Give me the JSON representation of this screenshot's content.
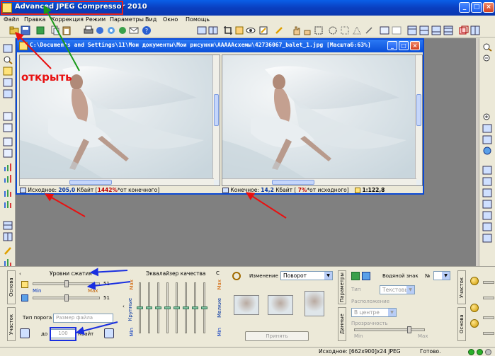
{
  "app": {
    "title": "Advanced JPEG Compressor 2010",
    "window_buttons": [
      "_",
      "□",
      "×"
    ]
  },
  "menu": [
    "Файл",
    "Правка",
    "Коррекция",
    "Режим",
    "Параметры",
    "Вид",
    "Окно",
    "Помощь"
  ],
  "document": {
    "title": "C:\\Documents and Settings\\11\\Мои документы\\Мои рисунки\\АААААсхемы\\42736067_balet_1.jpg [Масштаб:63%]",
    "buttons": [
      "_",
      "□",
      "×"
    ],
    "original_status": {
      "label": "Исходное:",
      "size": "205,0",
      "unit": "Кбайт",
      "percent": "1442%",
      "suffix": "*от конечного"
    },
    "final_status": {
      "label": "Конечное:",
      "size": "14,2",
      "unit": "Кбайт",
      "percent": "7%",
      "suffix": "*от исходного",
      "ratio": "1:122,8"
    }
  },
  "annotation": {
    "text": "открыть",
    "colors": {
      "red": "#e81010",
      "green": "#1a9a1a",
      "blue": "#1a2fe0"
    }
  },
  "bottom": {
    "tab_left_1": "Основа",
    "tab_left_2": "Участок",
    "compression": {
      "title": "Уровни сжатия",
      "slider1_value": "51",
      "slider2_value": "51",
      "min_label": "Min",
      "max_label": "Max"
    },
    "threshold": {
      "label": "Тип порога",
      "placeholder": "Размер файла",
      "to_label": "до",
      "value": "100",
      "unit": "Кбайт"
    },
    "equalizer": {
      "title": "Эквалайзер качества",
      "c_label": "С",
      "left_label": "Крупные",
      "right_label": "Мелкие",
      "max_label": "Max",
      "min_label": "Min",
      "levels": [
        0.5,
        0.5,
        0.5,
        0.5,
        0.5,
        0.5,
        0.5,
        0.5
      ]
    },
    "change": {
      "label": "Изменение",
      "selected": "Поворот",
      "apply": "Принять"
    },
    "right_tab_1": "Параметры",
    "right_tab_2": "Данные",
    "watermark": {
      "title": "Водяной знак",
      "number_label": "№",
      "type_label": "Тип",
      "type_value": "Текстовы",
      "location_label": "Расположение",
      "location_value": "В центре",
      "transparency_label": "Прозрачность",
      "min_label": "Min",
      "max_label": "Max"
    },
    "far_right_tab_1": "Участок",
    "far_right_tab_2": "Основа"
  },
  "statusbar": {
    "info": "Исходное: [662x900]x24 JPEG",
    "state": "Готово."
  }
}
